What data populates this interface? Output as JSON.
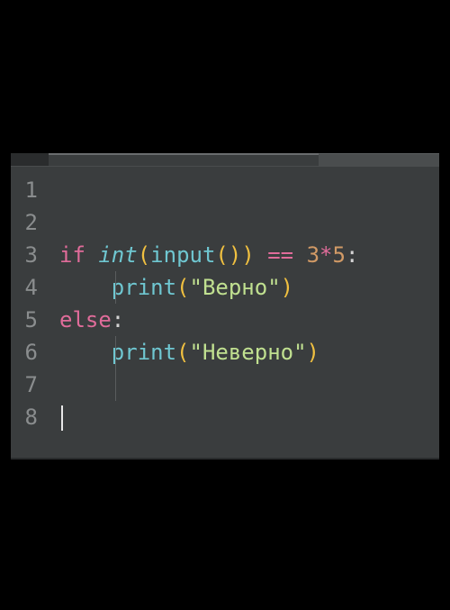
{
  "gutter": {
    "lines": [
      "1",
      "2",
      "3",
      "4",
      "5",
      "6",
      "7",
      "8"
    ]
  },
  "code": {
    "line3": {
      "kw_if": "if",
      "int": "int",
      "p1": "(",
      "input": "input",
      "p2": "(",
      "p3": ")",
      "p4": ")",
      "eq": " == ",
      "n3": "3",
      "star": "*",
      "n5": "5",
      "colon": ":"
    },
    "line4": {
      "print": "print",
      "p1": "(",
      "str": "\"Верно\"",
      "p2": ")"
    },
    "line5": {
      "kw_else": "else",
      "colon": ":"
    },
    "line6": {
      "print": "print",
      "p1": "(",
      "str": "\"Неверно\"",
      "p2": ")"
    }
  },
  "colors": {
    "background": "#3a3d3e",
    "gutter_text": "#8a8d8e",
    "keyword": "#e06c9a",
    "builtin": "#6fc7d1",
    "paren": "#f0c040",
    "number": "#d19a66",
    "string": "#c0e090",
    "default": "#d4d4d4"
  }
}
